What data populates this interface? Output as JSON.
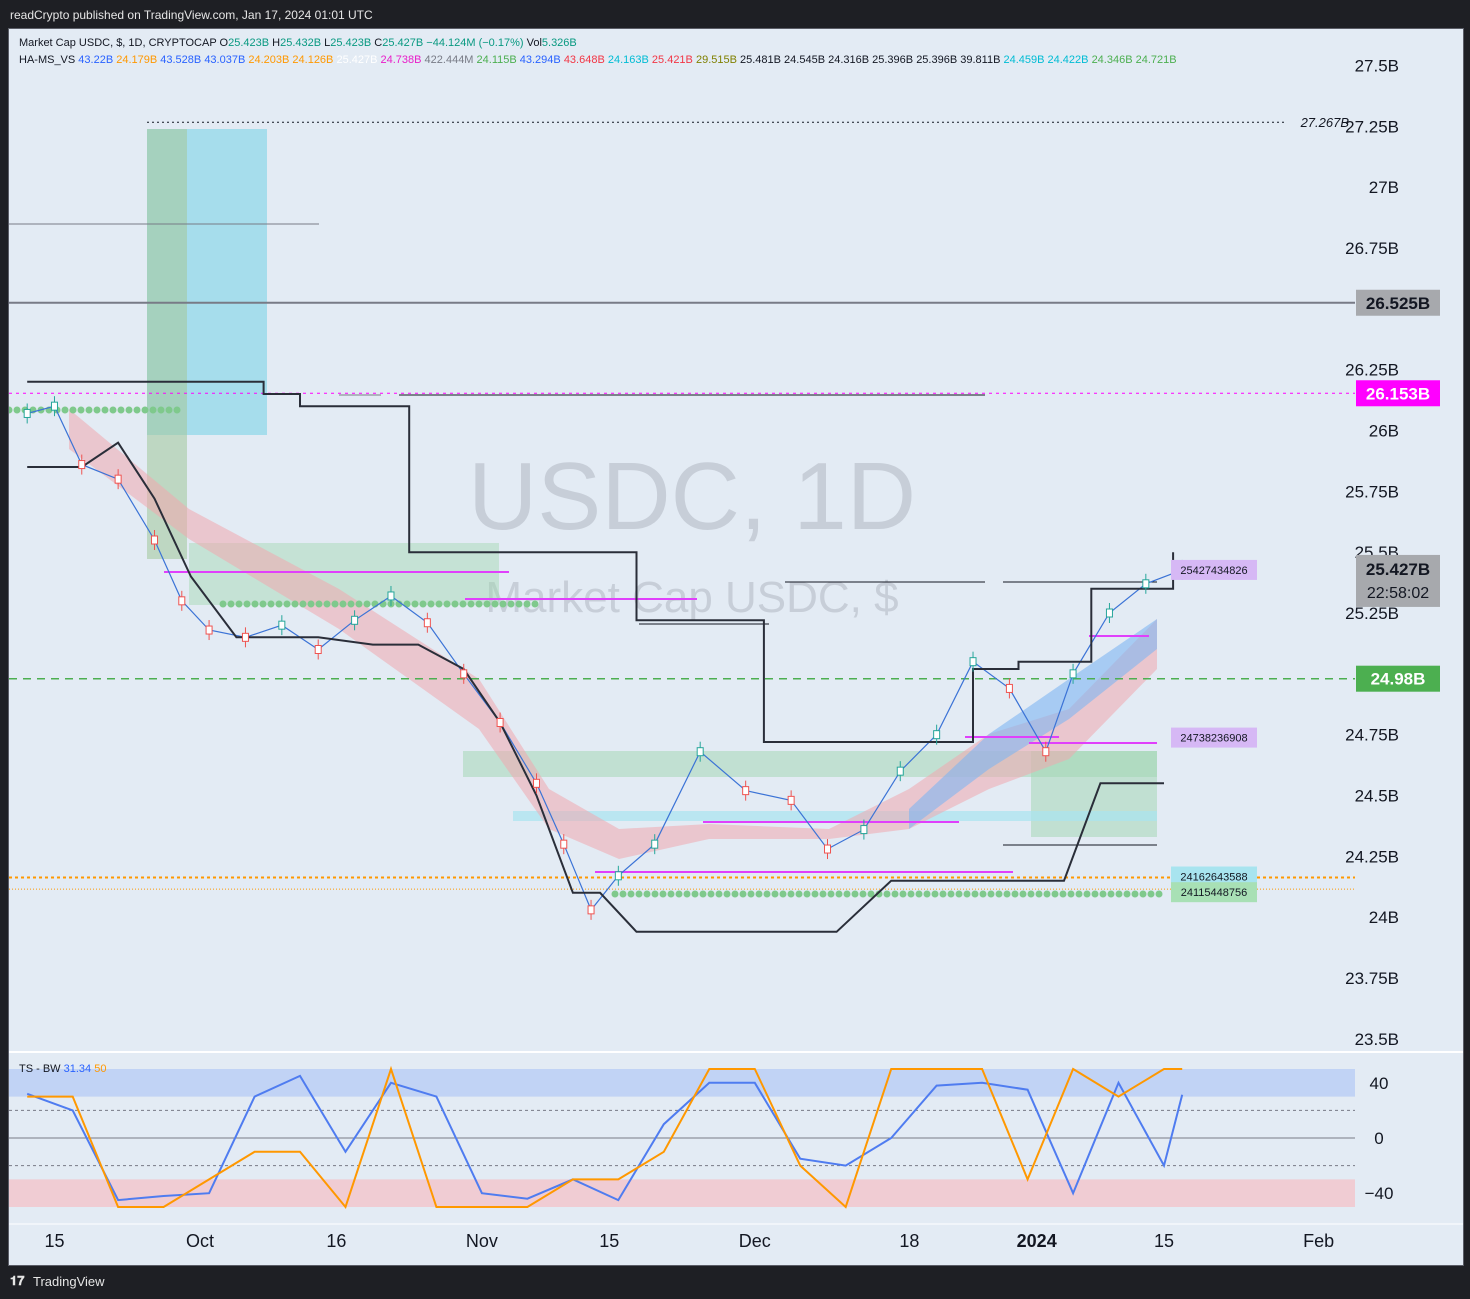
{
  "header": {
    "publish_line": "readCrypto published on TradingView.com, Jan 17, 2024 01:01 UTC"
  },
  "legend": {
    "symbol": "Market Cap USDC, $, 1D, CRYPTOCAP",
    "o_label": "O",
    "o_value": "25.423B",
    "h_label": "H",
    "h_value": "25.432B",
    "l_label": "L",
    "l_value": "25.423B",
    "c_label": "C",
    "c_value": "25.427B",
    "change": "−44.124M (−0.17%)",
    "vol_label": "Vol",
    "vol_value": "5.326B",
    "indicator_name": "HA-MS_VS",
    "indicator_values": [
      {
        "text": "43.22B",
        "color": "#2962ff"
      },
      {
        "text": "24.179B",
        "color": "#ff9800"
      },
      {
        "text": "43.528B",
        "color": "#2962ff"
      },
      {
        "text": "43.037B",
        "color": "#2962ff"
      },
      {
        "text": "24.203B",
        "color": "#ff9800"
      },
      {
        "text": "24.126B",
        "color": "#ff9800"
      },
      {
        "text": "25.427B",
        "color": "#ffffff"
      },
      {
        "text": "24.738B",
        "color": "#e91ec9"
      },
      {
        "text": "422.444M",
        "color": "#787b86"
      },
      {
        "text": "24.115B",
        "color": "#4caf50"
      },
      {
        "text": "43.294B",
        "color": "#2962ff"
      },
      {
        "text": "43.648B",
        "color": "#f23645"
      },
      {
        "text": "24.163B",
        "color": "#00bcd4"
      },
      {
        "text": "25.421B",
        "color": "#f23645"
      },
      {
        "text": "29.515B",
        "color": "#808000"
      },
      {
        "text": "25.481B",
        "color": "#131722"
      },
      {
        "text": "24.545B",
        "color": "#131722"
      },
      {
        "text": "24.316B",
        "color": "#131722"
      },
      {
        "text": "25.396B",
        "color": "#131722"
      },
      {
        "text": "25.396B",
        "color": "#131722"
      },
      {
        "text": "39.811B",
        "color": "#131722"
      },
      {
        "text": "24.459B",
        "color": "#00bcd4"
      },
      {
        "text": "24.422B",
        "color": "#00bcd4"
      },
      {
        "text": "24.346B",
        "color": "#4caf50"
      },
      {
        "text": "24.721B",
        "color": "#4caf50"
      }
    ]
  },
  "watermark": {
    "main": "USDC, 1D",
    "sub": "Market Cap USDC, $"
  },
  "price_labels": {
    "high_marker": "27.267B",
    "level_gray": "26.525B",
    "level_magenta": "26.153B",
    "last_price": "25.427B",
    "countdown": "22:58:02",
    "level_green": "24.98B",
    "tag_1": "25427434826",
    "tag_2": "24738236908",
    "tag_3": "24162643588",
    "tag_4": "24115448756"
  },
  "oscillator": {
    "name": "TS - BW",
    "value_1": "31.34",
    "value_2": "50",
    "y_ticks": [
      "40",
      "0",
      "−40"
    ]
  },
  "footer": {
    "logo": "𝟏𝟕",
    "brand": "TradingView"
  },
  "colors": {
    "background": "#e3ebf4",
    "frame": "#1e1f24",
    "candle_up": "#26a69a",
    "candle_down": "#ef5350",
    "magenta": "#ff00ff",
    "orange": "#ff9800",
    "green_level": "#4caf50",
    "osc_blue": "#2962ff",
    "osc_orange": "#ff9800"
  },
  "chart_data": {
    "type": "line",
    "title": "Market Cap USDC, $, 1D, CRYPTOCAP",
    "y_unit": "USD (billions)",
    "y_ticks": [
      "27.5B",
      "27.25B",
      "27B",
      "26.75B",
      "26.525B",
      "26.25B",
      "26.153B",
      "26B",
      "25.75B",
      "25.5B",
      "25.427B",
      "25.25B",
      "24.98B",
      "24.75B",
      "24.5B",
      "24.25B",
      "24B",
      "23.75B",
      "23.5B"
    ],
    "ylim": [
      23.45,
      27.65
    ],
    "x_ticks": [
      "15",
      "Oct",
      "16",
      "Nov",
      "15",
      "Dec",
      "18",
      "2024",
      "15",
      "Feb"
    ],
    "x_dates": [
      "2023-09-15",
      "2023-10-01",
      "2023-10-16",
      "2023-11-01",
      "2023-11-15",
      "2023-12-01",
      "2023-12-18",
      "2024-01-01",
      "2024-01-15",
      "2024-02-01"
    ],
    "series": [
      {
        "name": "close",
        "x": [
          "2023-09-12",
          "2023-09-15",
          "2023-09-18",
          "2023-09-22",
          "2023-09-26",
          "2023-09-29",
          "2023-10-02",
          "2023-10-06",
          "2023-10-10",
          "2023-10-14",
          "2023-10-18",
          "2023-10-22",
          "2023-10-26",
          "2023-10-30",
          "2023-11-03",
          "2023-11-07",
          "2023-11-10",
          "2023-11-13",
          "2023-11-16",
          "2023-11-20",
          "2023-11-25",
          "2023-11-30",
          "2023-12-05",
          "2023-12-09",
          "2023-12-13",
          "2023-12-17",
          "2023-12-21",
          "2023-12-25",
          "2023-12-29",
          "2024-01-02",
          "2024-01-05",
          "2024-01-09",
          "2024-01-13",
          "2024-01-17"
        ],
        "y": [
          26.07,
          26.1,
          25.86,
          25.8,
          25.55,
          25.3,
          25.18,
          25.15,
          25.2,
          25.1,
          25.22,
          25.32,
          25.21,
          25.0,
          24.8,
          24.55,
          24.3,
          24.03,
          24.17,
          24.3,
          24.68,
          24.52,
          24.48,
          24.28,
          24.36,
          24.6,
          24.75,
          25.05,
          24.94,
          24.68,
          25.0,
          25.25,
          25.37,
          25.427
        ]
      },
      {
        "name": "trend",
        "x": [
          "2023-09-12",
          "2023-09-18",
          "2023-09-22",
          "2023-09-26",
          "2023-09-30",
          "2023-10-05",
          "2023-10-10",
          "2023-10-14",
          "2023-10-20",
          "2023-10-25",
          "2023-10-30",
          "2023-11-03",
          "2023-11-07",
          "2023-11-11",
          "2023-11-14",
          "2023-11-18",
          "2023-11-25",
          "2023-12-02",
          "2023-12-10",
          "2023-12-16",
          "2023-12-21",
          "2023-12-26",
          "2023-12-31",
          "2024-01-04",
          "2024-01-08",
          "2024-01-12",
          "2024-01-15"
        ],
        "y": [
          25.85,
          25.85,
          25.95,
          25.72,
          25.4,
          25.15,
          25.15,
          25.15,
          25.12,
          25.12,
          25.02,
          24.8,
          24.5,
          24.1,
          24.1,
          23.94,
          23.94,
          23.94,
          23.94,
          24.15,
          24.15,
          24.15,
          24.15,
          24.15,
          24.55,
          24.55,
          24.55
        ]
      },
      {
        "name": "stair",
        "x": [
          "2023-09-12",
          "2023-09-20",
          "2023-09-26",
          "2023-10-01",
          "2023-10-08",
          "2023-10-12",
          "2023-10-17",
          "2023-10-24",
          "2023-10-30",
          "2023-11-05",
          "2023-11-12",
          "2023-11-18",
          "2023-11-24",
          "2023-12-02",
          "2023-12-10",
          "2023-12-16",
          "2023-12-20",
          "2023-12-25",
          "2023-12-30",
          "2024-01-03",
          "2024-01-07",
          "2024-01-12",
          "2024-01-16"
        ],
        "y": [
          26.2,
          26.2,
          26.2,
          26.2,
          26.15,
          26.1,
          26.1,
          25.5,
          25.5,
          25.5,
          25.5,
          25.22,
          25.22,
          24.72,
          24.72,
          24.72,
          24.72,
          25.02,
          25.05,
          25.05,
          25.35,
          25.35,
          25.5
        ]
      }
    ],
    "levels": [
      {
        "label": "27.267B",
        "value": 27.267
      },
      {
        "label": "26.525B",
        "value": 26.525
      },
      {
        "label": "26.153B",
        "value": 26.153
      },
      {
        "label": "24.98B",
        "value": 24.98
      },
      {
        "label": "24162643588",
        "value": 24.163
      },
      {
        "label": "24115448756",
        "value": 24.115
      }
    ],
    "oscillator": {
      "name": "TS - BW",
      "ylim": [
        -50,
        50
      ],
      "series": [
        {
          "name": "31.34",
          "x": [
            "2023-09-12",
            "2023-09-17",
            "2023-09-22",
            "2023-09-27",
            "2023-10-02",
            "2023-10-07",
            "2023-10-12",
            "2023-10-17",
            "2023-10-22",
            "2023-10-27",
            "2023-11-01",
            "2023-11-06",
            "2023-11-11",
            "2023-11-16",
            "2023-11-21",
            "2023-11-26",
            "2023-12-01",
            "2023-12-06",
            "2023-12-11",
            "2023-12-16",
            "2023-12-21",
            "2023-12-26",
            "2023-12-31",
            "2024-01-05",
            "2024-01-10",
            "2024-01-15",
            "2024-01-17"
          ],
          "y": [
            32,
            20,
            -45,
            -42,
            -40,
            30,
            45,
            -10,
            40,
            30,
            -40,
            -44,
            -30,
            -45,
            10,
            40,
            40,
            -15,
            -20,
            0,
            38,
            40,
            35,
            -40,
            40,
            -20,
            31.34
          ]
        },
        {
          "name": "50",
          "x": [
            "2023-09-12",
            "2023-09-17",
            "2023-09-22",
            "2023-09-27",
            "2023-10-02",
            "2023-10-07",
            "2023-10-12",
            "2023-10-17",
            "2023-10-22",
            "2023-10-27",
            "2023-11-01",
            "2023-11-06",
            "2023-11-11",
            "2023-11-16",
            "2023-11-21",
            "2023-11-26",
            "2023-12-01",
            "2023-12-06",
            "2023-12-11",
            "2023-12-16",
            "2023-12-21",
            "2023-12-26",
            "2023-12-31",
            "2024-01-05",
            "2024-01-10",
            "2024-01-15",
            "2024-01-17"
          ],
          "y": [
            30,
            30,
            -50,
            -50,
            -30,
            -10,
            -10,
            -50,
            50,
            -50,
            -50,
            -50,
            -30,
            -30,
            -10,
            50,
            50,
            -20,
            -50,
            50,
            50,
            50,
            -30,
            50,
            30,
            50,
            50
          ]
        }
      ],
      "y_ticks": [
        40,
        0,
        -40
      ]
    }
  }
}
